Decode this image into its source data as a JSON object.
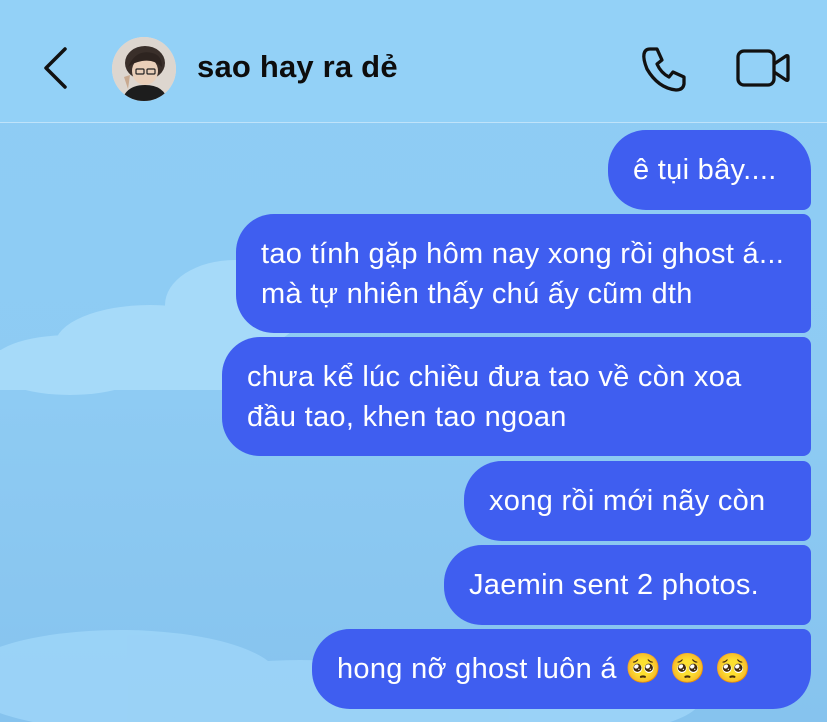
{
  "header": {
    "contact_name": "sao hay ra dẻ",
    "back_icon": "chevron-left-icon",
    "call_icon": "phone-icon",
    "video_icon": "video-camera-icon"
  },
  "messages": [
    {
      "text": "ê tụi bây...."
    },
    {
      "text": "tao tính gặp hôm nay xong rồi ghost á... mà tự nhiên thấy chú ấy cũm dth"
    },
    {
      "text": "chưa kể lúc chiều đưa tao về còn xoa đầu tao, khen tao ngoan"
    },
    {
      "text": "xong rồi mới nãy còn"
    },
    {
      "text": "Jaemin sent 2 photos."
    },
    {
      "text": "hong nỡ ghost luôn á 🥺 🥺 🥺"
    }
  ],
  "colors": {
    "background": "#8fcdf5",
    "bubble": "#3f5ef0",
    "bubble_text": "#ffffff",
    "header_text": "#0d0d0d"
  }
}
